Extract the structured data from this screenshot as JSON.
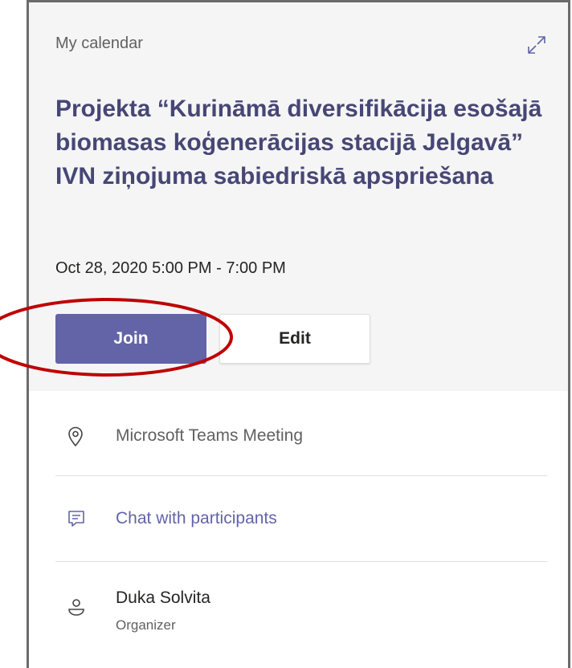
{
  "header": {
    "calendar_label": "My calendar",
    "expand_icon": "expand-icon"
  },
  "meeting": {
    "title": "Projekta “Kurināmā diversifikācija esošajā biomasas koģenerācijas stacijā Jelgavā” IVN ziņojuma sabiedriskā apspriešana",
    "datetime": "Oct 28, 2020 5:00 PM - 7:00 PM"
  },
  "actions": {
    "join_label": "Join",
    "edit_label": "Edit"
  },
  "details": {
    "location": "Microsoft Teams Meeting",
    "chat": "Chat with participants",
    "organizer_name": "Duka Solvita",
    "organizer_role": "Organizer"
  },
  "colors": {
    "brand": "#6264a7",
    "title": "#464775",
    "annotation": "#c00000"
  }
}
